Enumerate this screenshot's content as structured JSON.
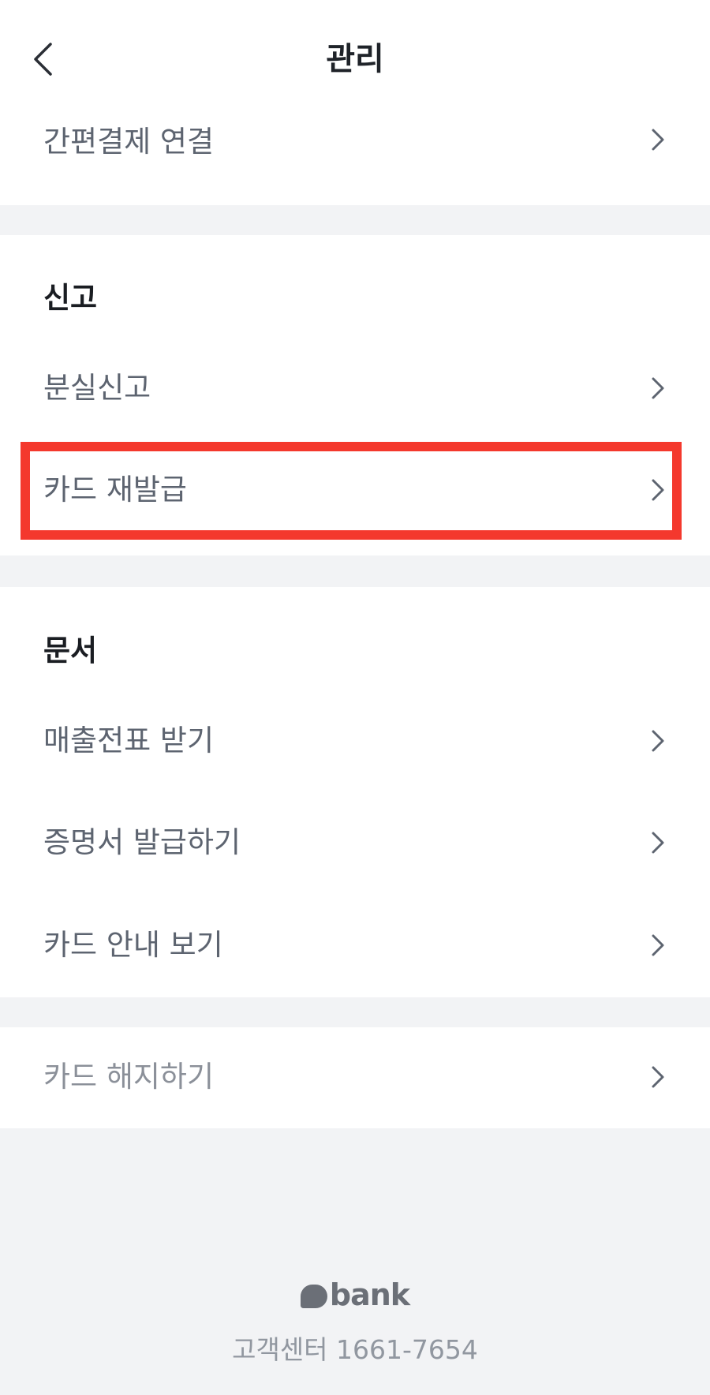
{
  "header": {
    "title": "관리",
    "back_icon": "chevron-left-icon"
  },
  "section_payment": {
    "items": [
      {
        "label": "간편결제 연결"
      }
    ]
  },
  "section_report": {
    "title": "신고",
    "items": [
      {
        "label": "분실신고"
      },
      {
        "label": "카드 재발급",
        "highlighted": true
      }
    ]
  },
  "section_documents": {
    "title": "문서",
    "items": [
      {
        "label": "매출전표 받기"
      },
      {
        "label": "증명서 발급하기"
      },
      {
        "label": "카드 안내 보기"
      }
    ]
  },
  "section_cancel": {
    "items": [
      {
        "label": "카드 해지하기"
      }
    ]
  },
  "footer": {
    "logo_text": "bank",
    "customer_center": "고객센터 1661-7654"
  },
  "colors": {
    "highlight_border": "#f4382d",
    "background": "#f2f3f5",
    "text_primary": "#1a1d22",
    "text_secondary": "#5d6470"
  }
}
